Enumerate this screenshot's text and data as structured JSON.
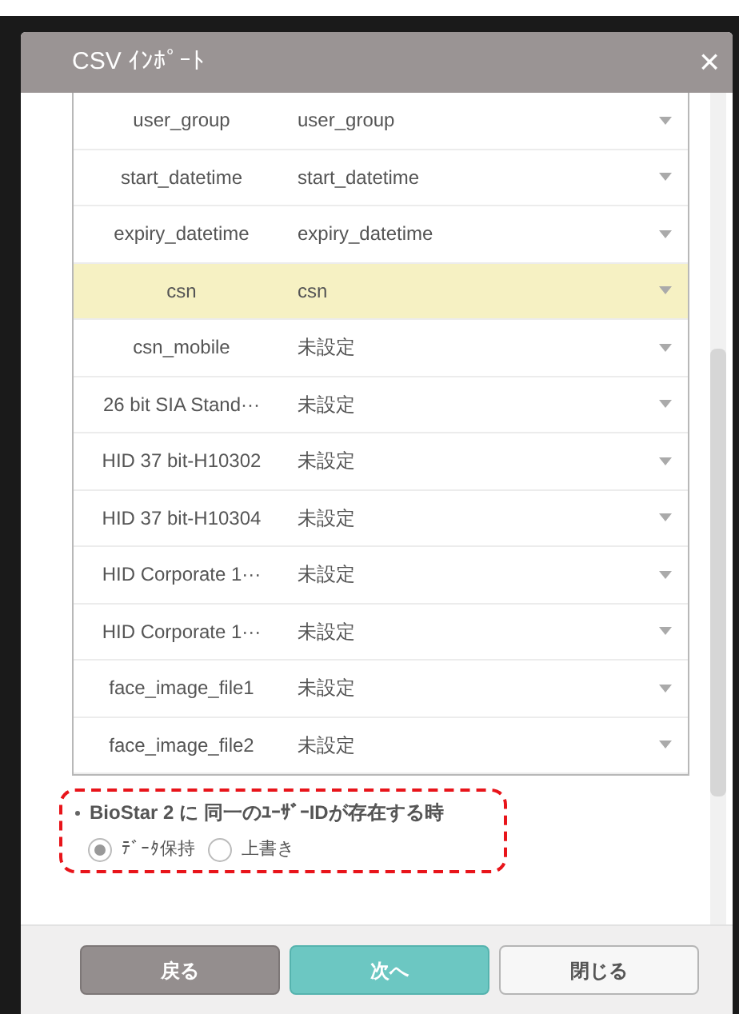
{
  "dialog": {
    "title": "CSV ｲﾝﾎﾟｰﾄ",
    "close": "×"
  },
  "mappings": [
    {
      "field": "user_group",
      "value": "user_group",
      "selected": false
    },
    {
      "field": "start_datetime",
      "value": "start_datetime",
      "selected": false
    },
    {
      "field": "expiry_datetime",
      "value": "expiry_datetime",
      "selected": false
    },
    {
      "field": "csn",
      "value": "csn",
      "selected": true
    },
    {
      "field": "csn_mobile",
      "value": "未設定",
      "selected": false
    },
    {
      "field": "26 bit SIA Stand···",
      "value": "未設定",
      "selected": false
    },
    {
      "field": "HID 37 bit-H10302",
      "value": "未設定",
      "selected": false
    },
    {
      "field": "HID 37 bit-H10304",
      "value": "未設定",
      "selected": false
    },
    {
      "field": "HID Corporate 1···",
      "value": "未設定",
      "selected": false
    },
    {
      "field": "HID Corporate 1···",
      "value": "未設定",
      "selected": false
    },
    {
      "field": "face_image_file1",
      "value": "未設定",
      "selected": false
    },
    {
      "field": "face_image_file2",
      "value": "未設定",
      "selected": false
    }
  ],
  "duplicate_option": {
    "label": "BioStar 2 に 同一のﾕｰｻﾞｰIDが存在する時",
    "options": [
      {
        "label": "ﾃﾞｰﾀ保持",
        "selected": true
      },
      {
        "label": "上書き",
        "selected": false
      }
    ]
  },
  "buttons": [
    {
      "label": "戻る",
      "kind": "back"
    },
    {
      "label": "次へ",
      "kind": "next"
    },
    {
      "label": "閉じる",
      "kind": "close"
    }
  ]
}
